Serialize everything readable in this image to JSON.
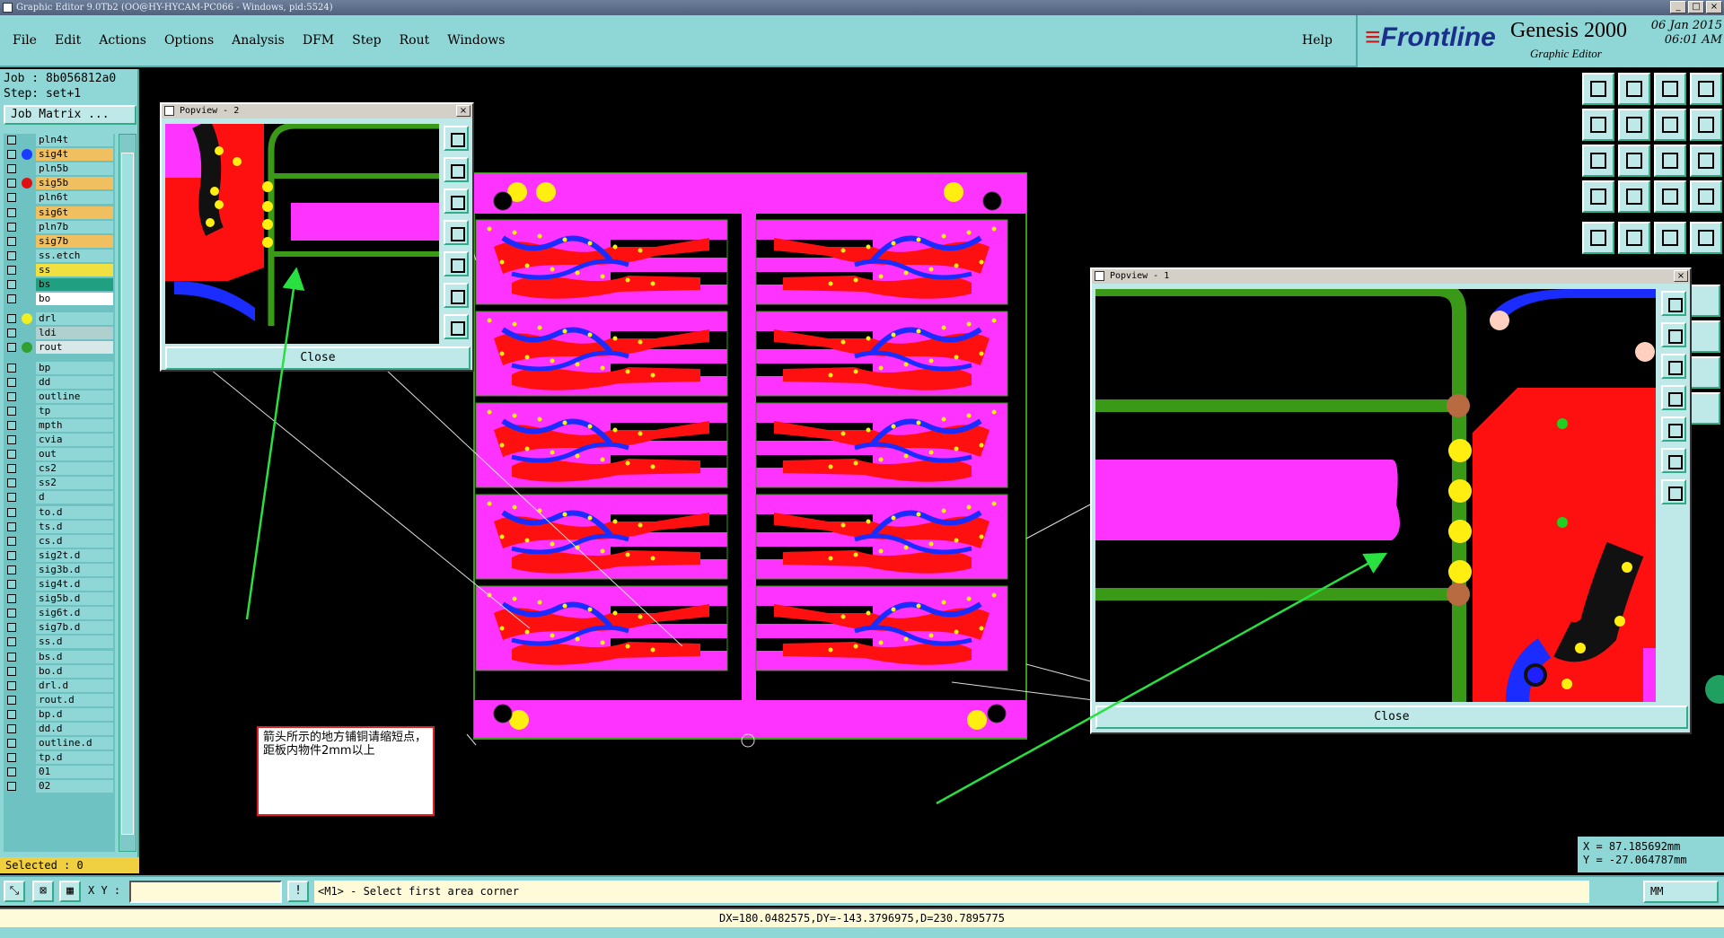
{
  "window": {
    "title": "Graphic Editor 9.0Tb2 (OO@HY-HYCAM-PC066 - Windows, pid:5524)",
    "controls": [
      "_",
      "□",
      "×"
    ]
  },
  "menu": {
    "items": [
      "File",
      "Edit",
      "Actions",
      "Options",
      "Analysis",
      "DFM",
      "Step",
      "Rout",
      "Windows"
    ],
    "help": "Help"
  },
  "brand": {
    "logo": "Frontline",
    "product": "Genesis 2000",
    "subtitle": "Graphic Editor",
    "date": "06 Jan 2015",
    "time": "06:01 AM"
  },
  "job": {
    "job_label": "Job : 8b056812a0",
    "step_label": "Step: set+1",
    "matrix_button": "Job Matrix ..."
  },
  "layers": [
    {
      "name": "pln4t",
      "color": "#6ec2c2",
      "bg": "#8fd6d6"
    },
    {
      "name": "sig4t",
      "color": "#1a3cff",
      "bg": "#f0c060"
    },
    {
      "name": "pln5b",
      "color": "#6ec2c2",
      "bg": "#8fd6d6"
    },
    {
      "name": "sig5b",
      "color": "#e01010",
      "bg": "#f0c060"
    },
    {
      "name": "pln6t",
      "color": "#6ec2c2",
      "bg": "#8fd6d6"
    },
    {
      "name": "sig6t",
      "color": "#6ec2c2",
      "bg": "#f0c060"
    },
    {
      "name": "pln7b",
      "color": "#6ec2c2",
      "bg": "#8fd6d6"
    },
    {
      "name": "sig7b",
      "color": "#6ec2c2",
      "bg": "#f0c060"
    },
    {
      "name": "ss.etch",
      "color": "#6ec2c2",
      "bg": "#8fd6d6"
    },
    {
      "name": "ss",
      "color": "#6ec2c2",
      "bg": "#f0e040"
    },
    {
      "name": "bs",
      "color": "#6ec2c2",
      "bg": "#20a080"
    },
    {
      "name": "bo",
      "color": "#6ec2c2",
      "bg": "#ffffff"
    },
    {
      "name": "drl",
      "color": "#f0f020",
      "bg": "#8fd6d6"
    },
    {
      "name": "ldi",
      "color": "#6ec2c2",
      "bg": "#b0d0d0"
    },
    {
      "name": "rout",
      "color": "#30a030",
      "bg": "#d8e8e8"
    },
    {
      "name": "bp",
      "color": "#6ec2c2",
      "bg": "#8fd6d6"
    },
    {
      "name": "dd",
      "color": "#6ec2c2",
      "bg": "#8fd6d6"
    },
    {
      "name": "outline",
      "color": "#6ec2c2",
      "bg": "#8fd6d6"
    },
    {
      "name": "tp",
      "color": "#6ec2c2",
      "bg": "#8fd6d6"
    },
    {
      "name": "mpth",
      "color": "#6ec2c2",
      "bg": "#8fd6d6"
    },
    {
      "name": "cvia",
      "color": "#6ec2c2",
      "bg": "#8fd6d6"
    },
    {
      "name": "out",
      "color": "#6ec2c2",
      "bg": "#8fd6d6"
    },
    {
      "name": "cs2",
      "color": "#6ec2c2",
      "bg": "#8fd6d6"
    },
    {
      "name": "ss2",
      "color": "#6ec2c2",
      "bg": "#8fd6d6"
    },
    {
      "name": "d",
      "color": "#6ec2c2",
      "bg": "#8fd6d6"
    },
    {
      "name": "to.d",
      "color": "#6ec2c2",
      "bg": "#8fd6d6"
    },
    {
      "name": "ts.d",
      "color": "#6ec2c2",
      "bg": "#8fd6d6"
    },
    {
      "name": "cs.d",
      "color": "#6ec2c2",
      "bg": "#8fd6d6"
    },
    {
      "name": "sig2t.d",
      "color": "#6ec2c2",
      "bg": "#8fd6d6"
    },
    {
      "name": "sig3b.d",
      "color": "#6ec2c2",
      "bg": "#8fd6d6"
    },
    {
      "name": "sig4t.d",
      "color": "#6ec2c2",
      "bg": "#8fd6d6"
    },
    {
      "name": "sig5b.d",
      "color": "#6ec2c2",
      "bg": "#8fd6d6"
    },
    {
      "name": "sig6t.d",
      "color": "#6ec2c2",
      "bg": "#8fd6d6"
    },
    {
      "name": "sig7b.d",
      "color": "#6ec2c2",
      "bg": "#8fd6d6"
    },
    {
      "name": "ss.d",
      "color": "#6ec2c2",
      "bg": "#8fd6d6"
    },
    {
      "name": "bs.d",
      "color": "#6ec2c2",
      "bg": "#8fd6d6"
    },
    {
      "name": "bo.d",
      "color": "#6ec2c2",
      "bg": "#8fd6d6"
    },
    {
      "name": "drl.d",
      "color": "#6ec2c2",
      "bg": "#8fd6d6"
    },
    {
      "name": "rout.d",
      "color": "#6ec2c2",
      "bg": "#8fd6d6"
    },
    {
      "name": "bp.d",
      "color": "#6ec2c2",
      "bg": "#8fd6d6"
    },
    {
      "name": "dd.d",
      "color": "#6ec2c2",
      "bg": "#8fd6d6"
    },
    {
      "name": "outline.d",
      "color": "#6ec2c2",
      "bg": "#8fd6d6"
    },
    {
      "name": "tp.d",
      "color": "#6ec2c2",
      "bg": "#8fd6d6"
    },
    {
      "name": "01",
      "color": "#6ec2c2",
      "bg": "#8fd6d6"
    },
    {
      "name": "02",
      "color": "#6ec2c2",
      "bg": "#8fd6d6"
    }
  ],
  "selected_label": "Selected : 0",
  "popview2": {
    "title": "Popview - 2",
    "close": "Close"
  },
  "popview1": {
    "title": "Popview - 1",
    "close": "Close"
  },
  "annotation": "箭头所示的地方铺铜请缩短点，距板内物件2mm以上",
  "coords": {
    "x": "X = 87.185692mm",
    "y": "Y = -27.064787mm"
  },
  "bottom": {
    "xy_label": "X Y :",
    "xy_value": "",
    "prompt": "<M1> - Select first area corner",
    "units": "MM",
    "status": "DX=180.0482575,DY=-143.3796975,D=230.7895775"
  },
  "colors": {
    "pink": "#ff33ff",
    "red": "#ff1010",
    "blue": "#1a2cff",
    "green": "#3a9a18",
    "yellow": "#ffee10",
    "arrow": "#28e040"
  }
}
